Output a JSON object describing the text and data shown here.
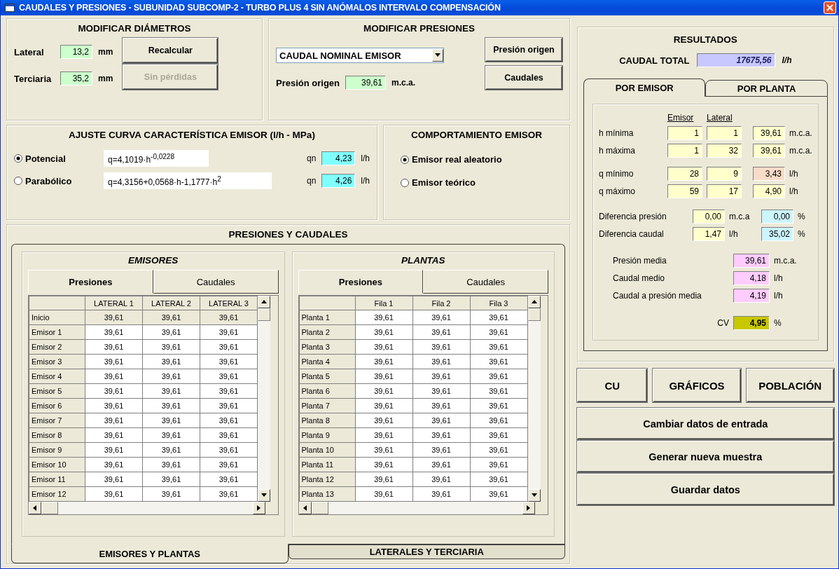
{
  "window": {
    "title": "CAUDALES Y PRESIONES - SUBUNIDAD SUBCOMP-2 - TURBO PLUS 4 SIN ANÓMALOS INTERVALO COMPENSACIÓN"
  },
  "diametros": {
    "title": "MODIFICAR DIÁMETROS",
    "rows": [
      {
        "label": "Lateral",
        "value": "13,2",
        "unit": "mm"
      },
      {
        "label": "Terciaria",
        "value": "35,2",
        "unit": "mm"
      }
    ],
    "buttons": [
      {
        "label": "Recalcular",
        "disabled": false
      },
      {
        "label": "Sin pérdidas",
        "disabled": true
      }
    ]
  },
  "presiones": {
    "title": "MODIFICAR PRESIONES",
    "dropdown": "CAUDAL NOMINAL EMISOR",
    "label": "Presión origen",
    "value": "39,61",
    "unit": "m.c.a.",
    "buttons": [
      {
        "label": "Presión origen"
      },
      {
        "label": "Caudales"
      }
    ]
  },
  "ajuste": {
    "title": "AJUSTE CURVA CARACTERÍSTICA EMISOR (l/h - MPa)",
    "options": [
      {
        "label": "Potencial",
        "selected": true,
        "formula": "q=4,1019·h$^{-0,0228}$",
        "qn_label": "qn",
        "qn": "4,23",
        "unit": "l/h"
      },
      {
        "label": "Parabólico",
        "selected": false,
        "formula": "q=4,3156+0,0568·h-1,1777·h$^{2}$",
        "qn_label": "qn",
        "qn": "4,26",
        "unit": "l/h"
      }
    ]
  },
  "comportamiento": {
    "title": "COMPORTAMIENTO EMISOR",
    "options": [
      {
        "label": "Emisor real aleatorio",
        "selected": true
      },
      {
        "label": "Emisor teórico",
        "selected": false
      }
    ]
  },
  "presiones_y_caudales": {
    "title": "PRESIONES Y CAUDALES",
    "tabs": [
      {
        "label": "EMISORES Y PLANTAS",
        "selected": true
      },
      {
        "label": "LATERALES Y TERCIARIA",
        "selected": false
      }
    ],
    "panels": [
      {
        "title": "EMISORES",
        "tabs": [
          {
            "label": "Presiones",
            "selected": true
          },
          {
            "label": "Caudales",
            "selected": false
          }
        ],
        "columns": [
          "LATERAL 1",
          "LATERAL 2",
          "LATERAL 3"
        ],
        "rows": [
          {
            "label": "Inicio",
            "kind": "fixed",
            "cells": [
              "39,61",
              "39,61",
              "39,61"
            ]
          },
          {
            "label": "Emisor 1",
            "kind": "data",
            "cells": [
              "39,61",
              "39,61",
              "39,61"
            ]
          },
          {
            "label": "Emisor 2",
            "kind": "data",
            "cells": [
              "39,61",
              "39,61",
              "39,61"
            ]
          },
          {
            "label": "Emisor 3",
            "kind": "data",
            "cells": [
              "39,61",
              "39,61",
              "39,61"
            ]
          },
          {
            "label": "Emisor 4",
            "kind": "data",
            "cells": [
              "39,61",
              "39,61",
              "39,61"
            ]
          },
          {
            "label": "Emisor 5",
            "kind": "data",
            "cells": [
              "39,61",
              "39,61",
              "39,61"
            ]
          },
          {
            "label": "Emisor 6",
            "kind": "data",
            "cells": [
              "39,61",
              "39,61",
              "39,61"
            ]
          },
          {
            "label": "Emisor 7",
            "kind": "data",
            "cells": [
              "39,61",
              "39,61",
              "39,61"
            ]
          },
          {
            "label": "Emisor 8",
            "kind": "data",
            "cells": [
              "39,61",
              "39,61",
              "39,61"
            ]
          },
          {
            "label": "Emisor 9",
            "kind": "data",
            "cells": [
              "39,61",
              "39,61",
              "39,61"
            ]
          },
          {
            "label": "Emisor 10",
            "kind": "data",
            "cells": [
              "39,61",
              "39,61",
              "39,61"
            ]
          },
          {
            "label": "Emisor 11",
            "kind": "data",
            "cells": [
              "39,61",
              "39,61",
              "39,61"
            ]
          },
          {
            "label": "Emisor 12",
            "kind": "data",
            "cells": [
              "39,61",
              "39,61",
              "39,61"
            ]
          }
        ]
      },
      {
        "title": "PLANTAS",
        "tabs": [
          {
            "label": "Presiones",
            "selected": true
          },
          {
            "label": "Caudales",
            "selected": false
          }
        ],
        "columns": [
          "Fila 1",
          "Fila 2",
          "Fila 3"
        ],
        "rows": [
          {
            "label": "Planta 1",
            "kind": "data",
            "cells": [
              "39,61",
              "39,61",
              "39,61"
            ]
          },
          {
            "label": "Planta 2",
            "kind": "data",
            "cells": [
              "39,61",
              "39,61",
              "39,61"
            ]
          },
          {
            "label": "Planta 3",
            "kind": "data",
            "cells": [
              "39,61",
              "39,61",
              "39,61"
            ]
          },
          {
            "label": "Planta 4",
            "kind": "data",
            "cells": [
              "39,61",
              "39,61",
              "39,61"
            ]
          },
          {
            "label": "Planta 5",
            "kind": "data",
            "cells": [
              "39,61",
              "39,61",
              "39,61"
            ]
          },
          {
            "label": "Planta 6",
            "kind": "data",
            "cells": [
              "39,61",
              "39,61",
              "39,61"
            ]
          },
          {
            "label": "Planta 7",
            "kind": "data",
            "cells": [
              "39,61",
              "39,61",
              "39,61"
            ]
          },
          {
            "label": "Planta 8",
            "kind": "data",
            "cells": [
              "39,61",
              "39,61",
              "39,61"
            ]
          },
          {
            "label": "Planta 9",
            "kind": "data",
            "cells": [
              "39,61",
              "39,61",
              "39,61"
            ]
          },
          {
            "label": "Planta 10",
            "kind": "data",
            "cells": [
              "39,61",
              "39,61",
              "39,61"
            ]
          },
          {
            "label": "Planta 11",
            "kind": "data",
            "cells": [
              "39,61",
              "39,61",
              "39,61"
            ]
          },
          {
            "label": "Planta 12",
            "kind": "data",
            "cells": [
              "39,61",
              "39,61",
              "39,61"
            ]
          },
          {
            "label": "Planta 13",
            "kind": "data",
            "cells": [
              "39,61",
              "39,61",
              "39,61"
            ]
          }
        ]
      }
    ]
  },
  "resultados": {
    "title": "RESULTADOS",
    "total_label": "CAUDAL TOTAL",
    "total_value": "17675,56",
    "total_unit": "l/h",
    "tabs": [
      {
        "label": "POR EMISOR",
        "selected": true
      },
      {
        "label": "POR PLANTA",
        "selected": false
      }
    ],
    "column_headers": [
      "Emisor",
      "Lateral"
    ],
    "rows": [
      {
        "label": "h mínima",
        "unit": "m.c.a.",
        "fields": [
          {
            "value": "1",
            "color": "#ffffcc"
          },
          {
            "value": "1",
            "color": "#ffffcc"
          },
          {
            "value": "39,61",
            "color": "#ffffcc"
          }
        ]
      },
      {
        "label": "h máxima",
        "unit": "m.c.a.",
        "fields": [
          {
            "value": "1",
            "color": "#ffffcc"
          },
          {
            "value": "32",
            "color": "#ffffcc"
          },
          {
            "value": "39,61",
            "color": "#ffffcc"
          }
        ]
      },
      {
        "label": "q mínimo",
        "unit": "l/h",
        "fields": [
          {
            "value": "28",
            "color": "#ffffcc"
          },
          {
            "value": "9",
            "color": "#ffffcc"
          },
          {
            "value": "3,43",
            "color": "#f8dcc8"
          }
        ]
      },
      {
        "label": "q máximo",
        "unit": "l/h",
        "fields": [
          {
            "value": "59",
            "color": "#ffffcc"
          },
          {
            "value": "17",
            "color": "#ffffcc"
          },
          {
            "value": "4,90",
            "color": "#ffffcc"
          }
        ]
      }
    ],
    "differences": [
      {
        "label": "Diferencia presión",
        "fields": [
          {
            "value": "0,00",
            "unit": "m.c.a",
            "color": "#ffffcc"
          },
          {
            "value": "0,00",
            "unit": "%",
            "color": "#ccf5ff"
          }
        ]
      },
      {
        "label": "Diferencia caudal",
        "fields": [
          {
            "value": "1,47",
            "unit": "l/h",
            "color": "#ffffcc"
          },
          {
            "value": "35,02",
            "unit": "%",
            "color": "#ccf5ff"
          }
        ]
      }
    ],
    "means": [
      {
        "kind": "mean",
        "label": "Presión media",
        "value": "39,61",
        "unit": "m.c.a.",
        "color": "#ffccff"
      },
      {
        "kind": "mean",
        "label": "Caudal medio",
        "value": "4,18",
        "unit": "l/h",
        "color": "#ffccff"
      },
      {
        "kind": "mean",
        "label": "Caudal a presión media",
        "value": "4,19",
        "unit": "l/h",
        "color": "#ffccff"
      },
      {
        "kind": "index",
        "label": "CV",
        "value": "4,95",
        "unit": "%",
        "color": "#c8c800"
      }
    ]
  },
  "small_buttons": [
    "CU",
    "GRÁFICOS",
    "POBLACIÓN"
  ],
  "big_buttons": [
    "Cambiar datos de entrada",
    "Generar nueva muestra",
    "Guardar datos"
  ]
}
